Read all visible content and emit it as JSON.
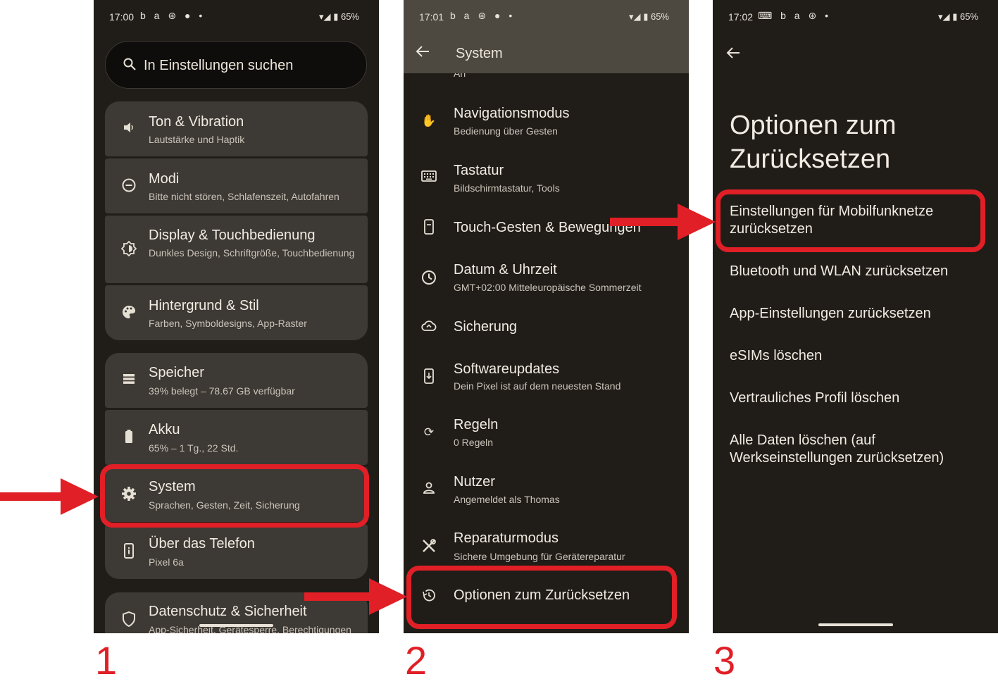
{
  "panel1": {
    "status": {
      "time": "17:00",
      "notif": "b a ⊛ ● •",
      "battery": "65%"
    },
    "search_placeholder": "In Einstellungen suchen",
    "items": [
      {
        "title": "Ton & Vibration",
        "sub": "Lautstärke und Haptik",
        "icon": "volume-icon"
      },
      {
        "title": "Modi",
        "sub": "Bitte nicht stören, Schlafenszeit, Autofahren",
        "icon": "modes-icon"
      },
      {
        "title": "Display & Touchbedienung",
        "sub": "Dunkles Design, Schriftgröße, Touchbedienung",
        "icon": "brightness-icon"
      },
      {
        "title": "Hintergrund & Stil",
        "sub": "Farben, Symboldesigns, App-Raster",
        "icon": "palette-icon"
      },
      {
        "title": "Speicher",
        "sub": "39% belegt – 78.67 GB verfügbar",
        "icon": "storage-icon"
      },
      {
        "title": "Akku",
        "sub": "65% – 1 Tg., 22 Std.",
        "icon": "battery-icon"
      },
      {
        "title": "System",
        "sub": "Sprachen, Gesten, Zeit, Sicherung",
        "icon": "gear-icon"
      },
      {
        "title": "Über das Telefon",
        "sub": "Pixel 6a",
        "icon": "phone-info-icon"
      },
      {
        "title": "Datenschutz & Sicherheit",
        "sub": "App-Sicherheit, Gerätesperre, Berechtigungen",
        "icon": "shield-icon"
      }
    ]
  },
  "panel2": {
    "status": {
      "time": "17:01",
      "notif": "b a ⊛ ● •",
      "battery": "65%"
    },
    "title": "System",
    "clipped": "An",
    "items": [
      {
        "title": "Navigationsmodus",
        "sub": "Bedienung über Gesten",
        "icon": "gesture-icon"
      },
      {
        "title": "Tastatur",
        "sub": "Bildschirmtastatur, Tools",
        "icon": "keyboard-icon"
      },
      {
        "title": "Touch-Gesten & Bewegungen",
        "sub": "",
        "icon": "touch-gesture-icon"
      },
      {
        "title": "Datum & Uhrzeit",
        "sub": "GMT+02:00 Mitteleuropäische Sommerzeit",
        "icon": "clock-icon"
      },
      {
        "title": "Sicherung",
        "sub": "",
        "icon": "cloud-backup-icon"
      },
      {
        "title": "Softwareupdates",
        "sub": "Dein Pixel ist auf dem neuesten Stand",
        "icon": "system-update-icon"
      },
      {
        "title": "Regeln",
        "sub": "0 Regeln",
        "icon": "rules-icon"
      },
      {
        "title": "Nutzer",
        "sub": "Angemeldet als Thomas",
        "icon": "person-icon"
      },
      {
        "title": "Reparaturmodus",
        "sub": "Sichere Umgebung für Gerätereparatur",
        "icon": "tools-icon"
      },
      {
        "title": "Optionen zum Zurücksetzen",
        "sub": "",
        "icon": "history-icon"
      }
    ]
  },
  "panel3": {
    "status": {
      "time": "17:02",
      "notif": "⌨ b a ⊛ •",
      "battery": "65%"
    },
    "heading": "Optionen zum Zurücksetzen",
    "options": [
      "Einstellungen für Mobilfunknetze zurücksetzen",
      "Bluetooth und WLAN zurücksetzen",
      "App-Einstellungen zurücksetzen",
      "eSIMs löschen",
      "Vertrauliches Profil löschen",
      "Alle Daten löschen (auf Werkseinstellungen zurücksetzen)"
    ]
  },
  "steps": [
    "1",
    "2",
    "3"
  ],
  "colors": {
    "highlight": "#e01f26",
    "background": "#201d19",
    "card": "#3d3934"
  }
}
